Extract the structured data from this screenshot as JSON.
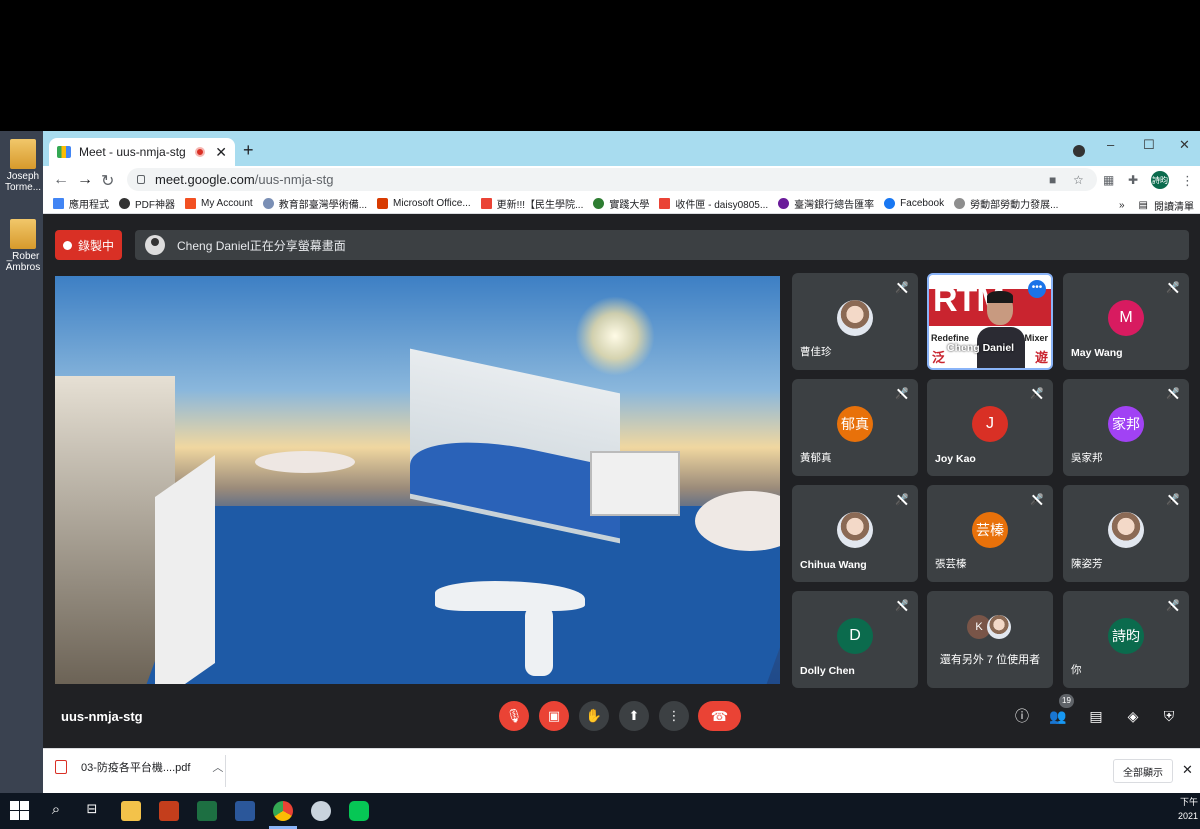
{
  "desktop": {
    "icons": [
      {
        "label1": "Joseph",
        "label2": "Torme..."
      },
      {
        "label1": "_Rober",
        "label2": "Ambros"
      }
    ]
  },
  "browser": {
    "tab_title": "Meet - uus-nmja-stg",
    "new_tab": "+",
    "url_host": "meet.google.com",
    "url_path": "/uus-nmja-stg",
    "profile_initial": "詩昀",
    "window_controls": [
      "–",
      "☐",
      "✕"
    ]
  },
  "bookmarks": {
    "items": [
      "應用程式",
      "PDF神器",
      "My Account",
      "教育部臺灣學術備...",
      "Microsoft Office...",
      "更新!!!【民生學院...",
      "實踐大學",
      "收件匣 - daisy0805...",
      "臺灣銀行總告匯率",
      "Facebook",
      "勞動部勞動力發展..."
    ],
    "overflow": "»",
    "reading_list": "閱讀清單"
  },
  "meet": {
    "recording_label": "錄製中",
    "presenting_text": "Cheng Daniel正在分享螢幕畫面",
    "meeting_code": "uus-nmja-stg",
    "participant_count": "19",
    "tiles": [
      {
        "name": "曹佳珍",
        "initial": "",
        "color": "#ffffff"
      },
      {
        "name": "Cheng Daniel",
        "initial": "",
        "color": "#c9242f"
      },
      {
        "name": "May Wang",
        "initial": "M",
        "color": "#d81b60"
      },
      {
        "name": "黃郁真",
        "initial": "郁真",
        "color": "#e8710a"
      },
      {
        "name": "Joy Kao",
        "initial": "J",
        "color": "#d93025"
      },
      {
        "name": "吳家邦",
        "initial": "家邦",
        "color": "#a142f4"
      },
      {
        "name": "Chihua Wang",
        "initial": "",
        "color": "#ffffff"
      },
      {
        "name": "張芸榛",
        "initial": "芸榛",
        "color": "#e8710a"
      },
      {
        "name": "陳姿芳",
        "initial": "",
        "color": "#ffffff"
      },
      {
        "name": "Dolly Chen",
        "initial": "D",
        "color": "#0b6b4d"
      },
      {
        "name": "還有另外 7 位使用者",
        "initial": "K",
        "color": "#795548"
      },
      {
        "name": "你",
        "initial": "詩昀",
        "color": "#0b6b4d"
      }
    ],
    "speaker_overlay": {
      "logo": "RTM",
      "left": "Redefine",
      "right": "Mixer",
      "cn_left": "泛",
      "cn_right": "遊"
    }
  },
  "downloads": {
    "file": "03-防疫各平台機....pdf",
    "show_all": "全部顯示"
  },
  "taskbar": {
    "clock_line1": "下午",
    "clock_line2": "2021"
  }
}
